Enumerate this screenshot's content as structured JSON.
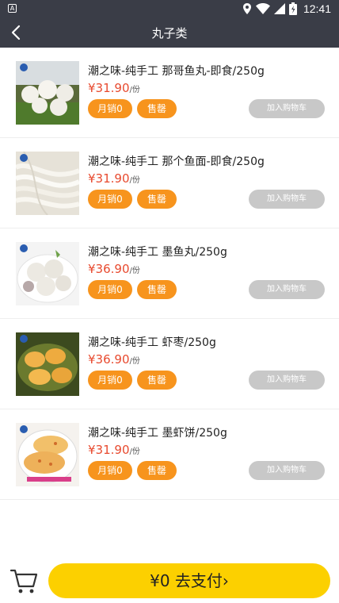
{
  "status_bar": {
    "app_badge": "A",
    "time": "12:41"
  },
  "header": {
    "title": "丸子类"
  },
  "products": [
    {
      "name": "潮之味-纯手工 那哥鱼丸-即食/250g",
      "price": "¥31.90",
      "unit": "/份",
      "sales": "月销0",
      "status": "售罄",
      "cart_label": "加入购物车"
    },
    {
      "name": "潮之味-纯手工 那个鱼面-即食/250g",
      "price": "¥31.90",
      "unit": "/份",
      "sales": "月销0",
      "status": "售罄",
      "cart_label": "加入购物车"
    },
    {
      "name": "潮之味-纯手工 墨鱼丸/250g",
      "price": "¥36.90",
      "unit": "/份",
      "sales": "月销0",
      "status": "售罄",
      "cart_label": "加入购物车"
    },
    {
      "name": "潮之味-纯手工 虾枣/250g",
      "price": "¥36.90",
      "unit": "/份",
      "sales": "月销0",
      "status": "售罄",
      "cart_label": "加入购物车"
    },
    {
      "name": "潮之味-纯手工 墨虾饼/250g",
      "price": "¥31.90",
      "unit": "/份",
      "sales": "月销0",
      "status": "售罄",
      "cart_label": "加入购物车"
    }
  ],
  "footer": {
    "pay_label": "¥0 去支付›"
  },
  "colors": {
    "header_bg": "#3a3d47",
    "price": "#e84a2f",
    "tag": "#f7941d",
    "pay_button": "#fcd000",
    "cart_button_disabled": "#c8c8c8"
  }
}
